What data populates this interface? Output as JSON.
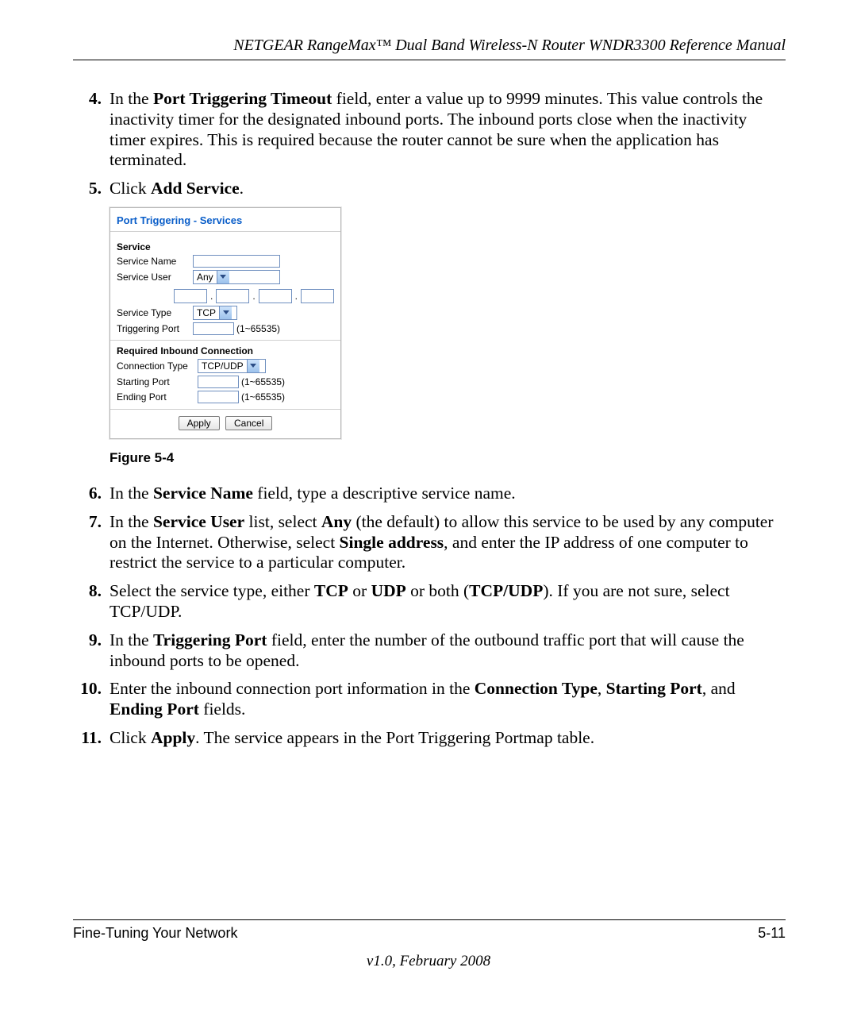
{
  "header": {
    "title": "NETGEAR RangeMax™ Dual Band Wireless-N Router WNDR3300 Reference Manual"
  },
  "steps": {
    "s4": {
      "num": "4.",
      "pre": "In the ",
      "b1": "Port Triggering Timeout",
      "post": " field, enter a value up to 9999 minutes. This value controls the inactivity timer for the designated inbound ports. The inbound ports close when the inactivity timer expires. This is required because the router cannot be sure when the application has terminated."
    },
    "s5": {
      "num": "5.",
      "pre": "Click ",
      "b1": "Add Service",
      "post": "."
    },
    "s6": {
      "num": "6.",
      "pre": "In the ",
      "b1": "Service Name",
      "post": " field, type a descriptive service name."
    },
    "s7": {
      "num": "7.",
      "pre": "In the ",
      "b1": "Service User",
      "mid1": " list, select ",
      "b2": "Any",
      "mid2": " (the default) to allow this service to be used by any computer on the Internet. Otherwise, select ",
      "b3": "Single address",
      "post": ", and enter the IP address of one computer to restrict the service to a particular computer."
    },
    "s8": {
      "num": "8.",
      "pre": "Select the service type, either ",
      "b1": "TCP",
      "mid1": " or ",
      "b2": "UDP",
      "mid2": " or both (",
      "b3": "TCP/UDP",
      "post": "). If you are not sure, select TCP/UDP."
    },
    "s9": {
      "num": "9.",
      "pre": "In the ",
      "b1": "Triggering Port",
      "post": " field, enter the number of the outbound traffic port that will cause the inbound ports to be opened."
    },
    "s10": {
      "num": "10.",
      "pre": "Enter the inbound connection port information in the ",
      "b1": "Connection Type",
      "mid1": ", ",
      "b2": "Starting Port",
      "mid2": ", and ",
      "b3": "Ending Port",
      "post": " fields."
    },
    "s11": {
      "num": "11.",
      "pre": "Click ",
      "b1": "Apply",
      "post": ". The service appears in the Port Triggering Portmap table."
    }
  },
  "figure": {
    "caption": "Figure 5-4",
    "title": "Port Triggering - Services",
    "service_heading": "Service",
    "labels": {
      "service_name": "Service Name",
      "service_user": "Service User",
      "service_type": "Service Type",
      "triggering_port": "Triggering Port",
      "required_inbound": "Required Inbound Connection",
      "connection_type": "Connection Type",
      "starting_port": "Starting Port",
      "ending_port": "Ending Port"
    },
    "values": {
      "service_user": "Any",
      "service_type": "TCP",
      "connection_type": "TCP/UDP",
      "range_hint": "(1~65535)"
    },
    "buttons": {
      "apply": "Apply",
      "cancel": "Cancel"
    }
  },
  "footer": {
    "section": "Fine-Tuning Your Network",
    "pagenum": "5-11",
    "version": "v1.0, February 2008"
  }
}
